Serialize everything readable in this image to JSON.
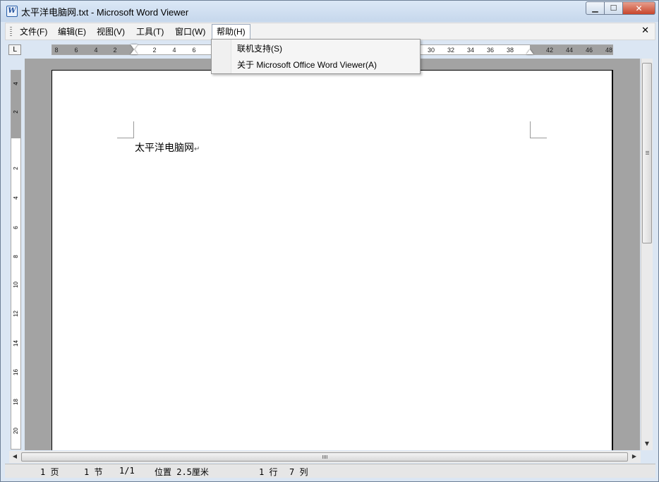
{
  "window": {
    "title": "太平洋电脑网.txt - Microsoft Word Viewer",
    "icon": "word-viewer-icon",
    "icon_glyph": "W",
    "buttons": {
      "minimize": "▁",
      "maximize": "☐",
      "close": "✕"
    }
  },
  "menubar": {
    "items": [
      {
        "label": "文件(F)"
      },
      {
        "label": "编辑(E)"
      },
      {
        "label": "视图(V)"
      },
      {
        "label": "工具(T)"
      },
      {
        "label": "窗口(W)"
      },
      {
        "label": "帮助(H)",
        "active": true
      }
    ],
    "close_glyph": "✕"
  },
  "help_menu": {
    "items": [
      {
        "label": "联机支持(S)"
      },
      {
        "label": "关于 Microsoft Office Word Viewer(A)"
      }
    ]
  },
  "ruler": {
    "corner_glyph": "L",
    "horizontal_labels": [
      "8",
      "6",
      "4",
      "2",
      "2",
      "4",
      "6",
      "30",
      "32",
      "34",
      "36",
      "38",
      "42",
      "44",
      "46",
      "48"
    ],
    "vertical_labels": [
      "4",
      "2",
      "2",
      "4",
      "6",
      "8",
      "10",
      "12",
      "14",
      "16",
      "18",
      "20"
    ]
  },
  "document": {
    "text": "太平洋电脑网",
    "paragraph_mark": "↵"
  },
  "scrollbars": {
    "up": "▲",
    "down": "▼",
    "left": "◀",
    "right": "▶"
  },
  "statusbar": {
    "page": "1 页",
    "section": "1 节",
    "page_of": "1/1",
    "position": "位置 2.5厘米",
    "line": "1 行",
    "column": "7 列"
  }
}
